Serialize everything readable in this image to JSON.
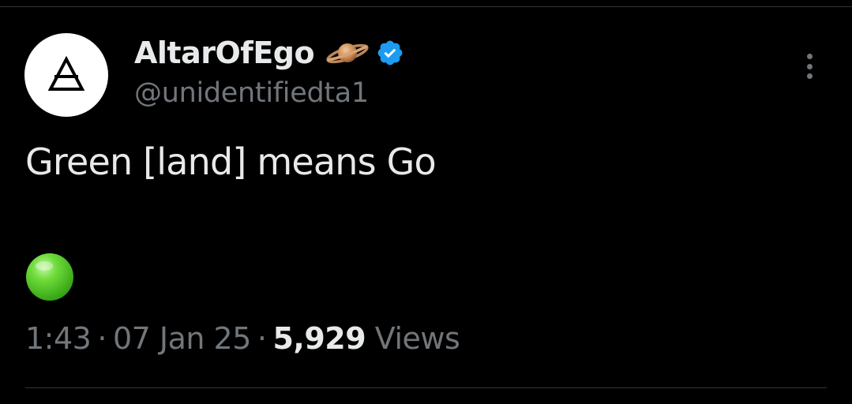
{
  "tweet": {
    "author": {
      "display_name": "AltarOfEgo",
      "handle": "@unidentifiedta1",
      "avatar_icon": "alchemical-triangle-icon",
      "name_emoji_icon": "ringed-planet-icon",
      "verified_icon": "verified-badge-icon"
    },
    "text": "Green [land] means Go",
    "emoji_icon": "green-circle-icon",
    "time": "1:43",
    "date": "07 Jan 25",
    "separator": "·",
    "views_count": "5,929",
    "views_label": "Views",
    "more_icon": "more-vertical-icon"
  },
  "colors": {
    "background": "#000000",
    "primary_text": "#e7e9ea",
    "secondary_text": "#71767b",
    "verified_blue": "#1d9bf0",
    "divider": "#2f3336",
    "orb_green": "#4cc71f"
  }
}
